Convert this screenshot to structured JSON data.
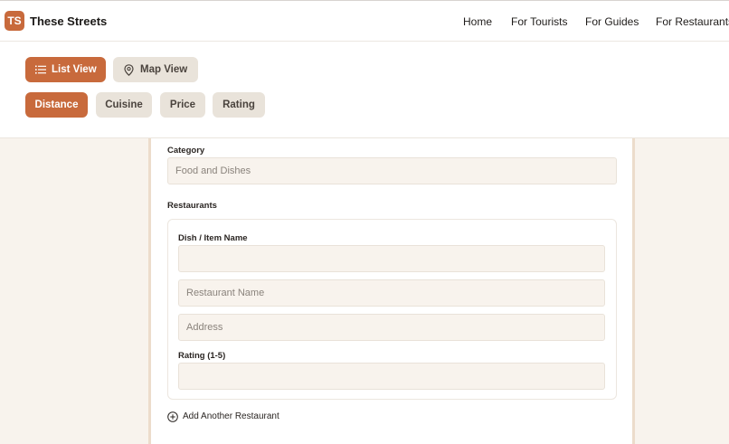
{
  "brand": {
    "logo_text": "TS",
    "name": "These Streets"
  },
  "nav": {
    "links": [
      "Home",
      "For Tourists",
      "For Guides",
      "For Restaurants"
    ]
  },
  "view_toggle": {
    "list_label": "List View",
    "map_label": "Map View",
    "active": "List View"
  },
  "filters": {
    "items": [
      "Distance",
      "Cuisine",
      "Price",
      "Rating"
    ],
    "active": "Distance"
  },
  "form": {
    "category": {
      "label": "Category",
      "value": "Food and Dishes"
    },
    "restaurants": {
      "label": "Restaurants",
      "dish_label": "Dish / Item Name",
      "dish_value": "",
      "restaurant_placeholder": "Restaurant Name",
      "address_placeholder": "Address",
      "rating_label": "Rating (1-5)",
      "rating_value": ""
    },
    "add_label": "Add Another Restaurant"
  },
  "colors": {
    "accent": "#c86a3c",
    "background": "#f8f3ed",
    "chip": "#e9e3da"
  }
}
